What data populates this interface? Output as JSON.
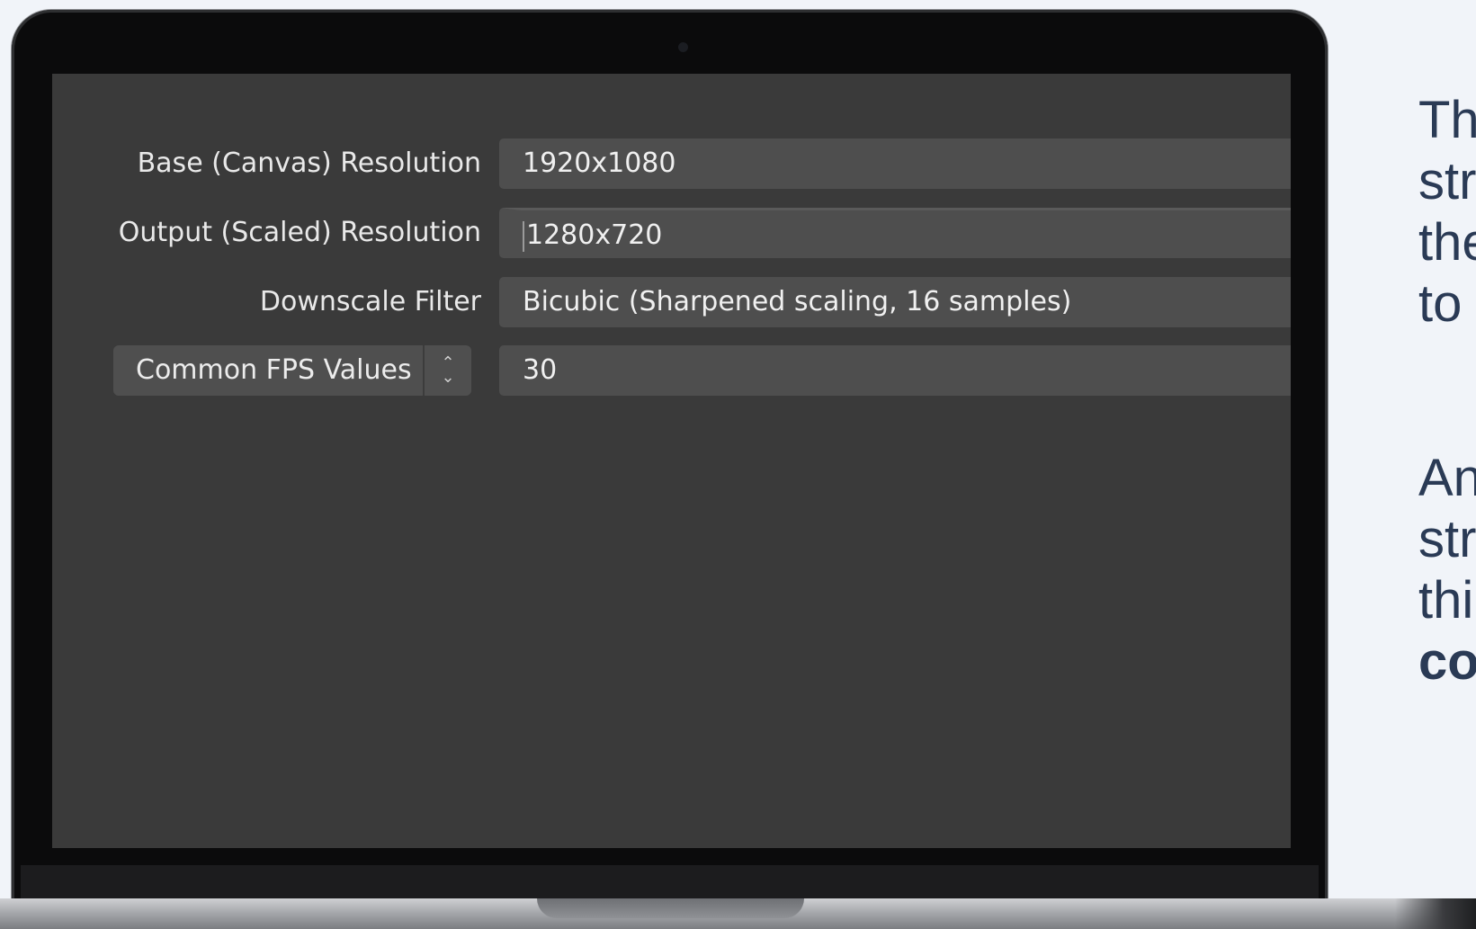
{
  "settings": {
    "base_resolution": {
      "label": "Base (Canvas) Resolution",
      "value": "1920x1080"
    },
    "output_resolution": {
      "label": "Output (Scaled) Resolution",
      "value": "1280x720"
    },
    "downscale_filter": {
      "label": "Downscale Filter",
      "value": "Bicubic (Sharpened scaling, 16 samples)"
    },
    "fps": {
      "mode_label": "Common FPS Values",
      "value": "30"
    }
  },
  "side_text": {
    "para1": [
      "Th",
      "str",
      "the",
      "to"
    ],
    "para2": [
      "An",
      "str",
      "thi",
      "co"
    ]
  }
}
